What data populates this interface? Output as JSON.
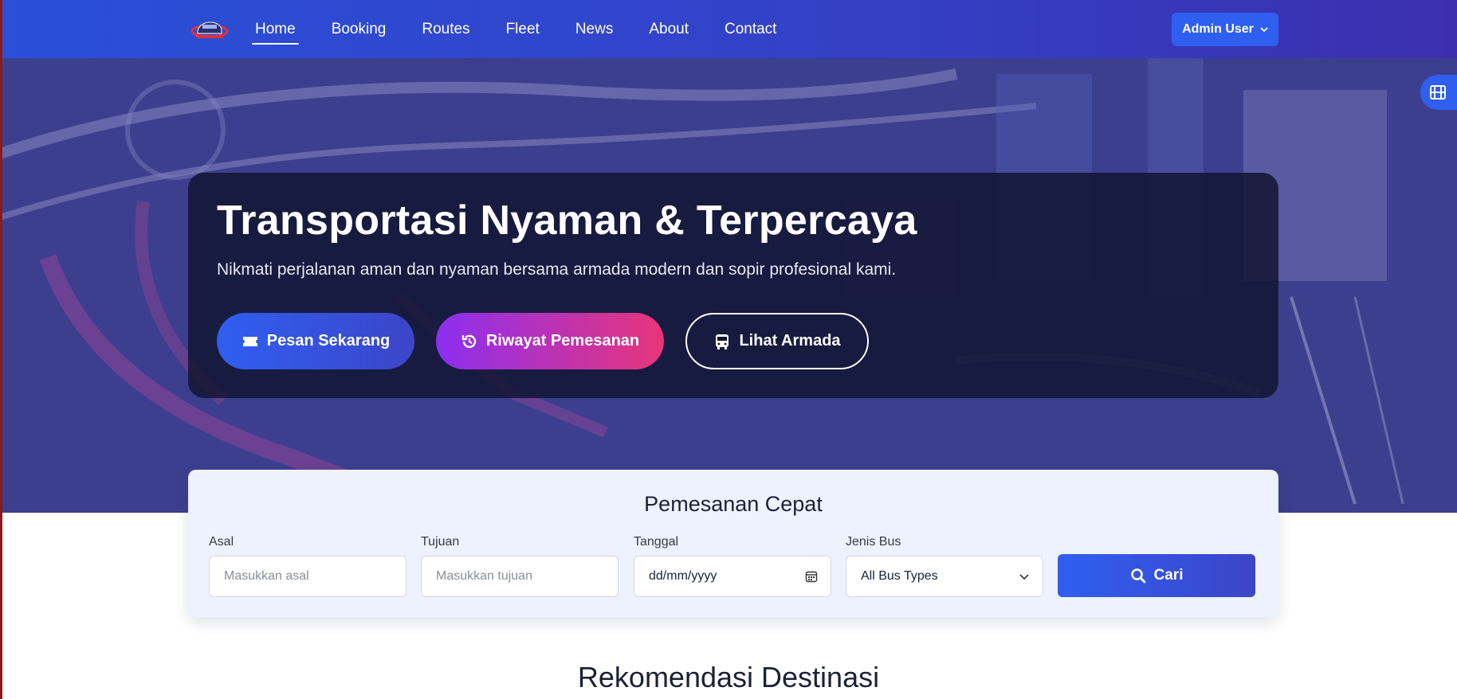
{
  "nav": {
    "logo_icon": "bus-logo",
    "links": [
      {
        "label": "Home",
        "active": true
      },
      {
        "label": "Booking"
      },
      {
        "label": "Routes"
      },
      {
        "label": "Fleet"
      },
      {
        "label": "News"
      },
      {
        "label": "About"
      },
      {
        "label": "Contact"
      }
    ],
    "user_label": "Admin User",
    "user_icon": "chevron-down-icon"
  },
  "side_button": {
    "icon": "film-icon"
  },
  "hero": {
    "title": "Transportasi Nyaman & Terpercaya",
    "subtitle": "Nikmati perjalanan aman dan nyaman bersama armada modern dan sopir profesional kami.",
    "buttons": {
      "book": {
        "label": "Pesan Sekarang",
        "icon": "ticket-icon"
      },
      "history": {
        "label": "Riwayat Pemesanan",
        "icon": "history-icon"
      },
      "fleet": {
        "label": "Lihat Armada",
        "icon": "bus-icon"
      }
    }
  },
  "quick_booking": {
    "title": "Pemesanan Cepat",
    "origin": {
      "label": "Asal",
      "placeholder": "Masukkan asal"
    },
    "destination": {
      "label": "Tujuan",
      "placeholder": "Masukkan tujuan"
    },
    "date": {
      "label": "Tanggal",
      "value": "dd/mm/yyyy",
      "icon": "calendar-icon"
    },
    "bus_type": {
      "label": "Jenis Bus",
      "value": "All Bus Types",
      "icon": "chevron-down-icon"
    },
    "search": {
      "label": "Cari",
      "icon": "search-icon"
    }
  },
  "recommend_title": "Rekomendasi Destinasi",
  "colors": {
    "primary": "#2f5ff0",
    "nav_gradient_end": "#3b2fae",
    "accent_purple": "#8b2ff0",
    "accent_pink": "#e8357a",
    "hero_card": "#11142f",
    "booking_bg": "#eef2fd"
  }
}
